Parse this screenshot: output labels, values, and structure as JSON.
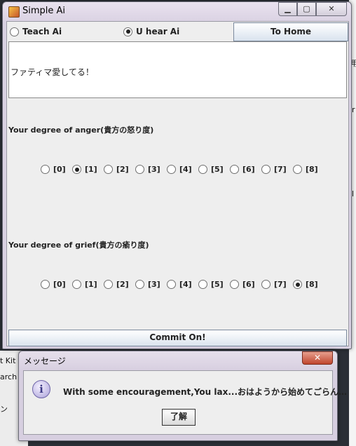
{
  "background": {
    "left_texts": [
      "t Kit",
      "arch",
      "ン"
    ],
    "right_texts": [
      "用",
      "r",
      "l"
    ]
  },
  "window": {
    "title": "Simple Ai",
    "top_row": {
      "teach_label": "Teach Ai",
      "hear_label": "U hear Ai",
      "selected": "U hear Ai",
      "home_button": "To Home"
    },
    "message_text": "ファティマ愛してる！",
    "anger": {
      "label": "Your degree of anger(貴方の怒り度)",
      "options": [
        "[0]",
        "[1]",
        "[2]",
        "[3]",
        "[4]",
        "[5]",
        "[6]",
        "[7]",
        "[8]"
      ],
      "selected_index": 1
    },
    "grief": {
      "label": "Your degree of grief(貴方の瘉り度)",
      "options": [
        "[0]",
        "[1]",
        "[2]",
        "[3]",
        "[4]",
        "[5]",
        "[6]",
        "[7]",
        "[8]"
      ],
      "selected_index": 8
    },
    "commit_button": "Commit On!"
  },
  "dialog": {
    "title": "メッセージ",
    "message": "With some encouragement,You lax...おはようから始めてごらん…",
    "ok_button": "了解"
  }
}
